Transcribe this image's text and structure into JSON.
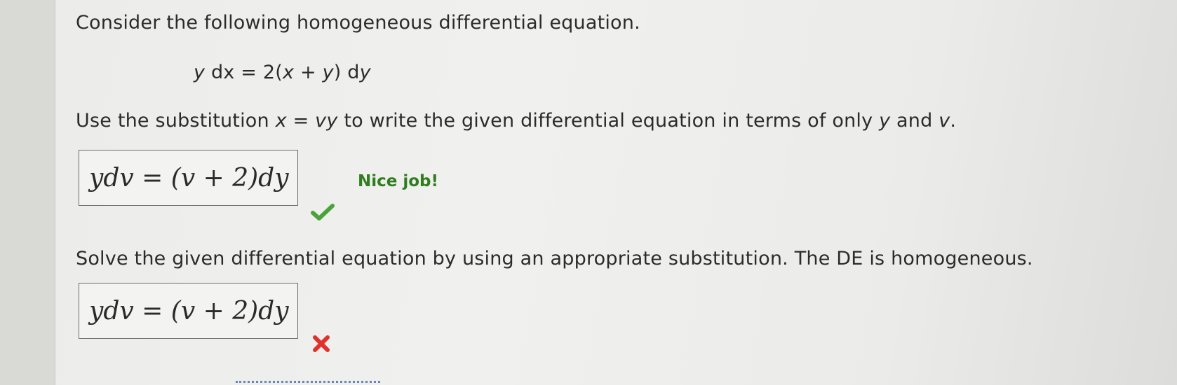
{
  "question": {
    "intro": "Consider the following homogeneous differential equation.",
    "equation": {
      "lhs_var": "y",
      "lhs_rest": " dx = 2(",
      "x": "x",
      "plus": " + ",
      "y": "y",
      "close": ") d",
      "dy_var": "y"
    },
    "part1": {
      "prompt_start": "Use the substitution ",
      "sub_x": "x",
      "sub_eq": " = ",
      "sub_vy": "vy",
      "prompt_mid": " to write the given differential equation in terms of only ",
      "var_y": "y",
      "and": " and ",
      "var_v": "v",
      "period": ".",
      "answer": "ydv = (v + 2)dy",
      "feedback": "Nice job!",
      "status_icon": "check-icon",
      "status_color": "#4aa33a"
    },
    "part2": {
      "prompt": "Solve the given differential equation by using an appropriate substitution. The DE is homogeneous.",
      "answer": "ydv = (v + 2)dy",
      "status_icon": "cross-icon",
      "status_color": "#e0322c"
    }
  }
}
